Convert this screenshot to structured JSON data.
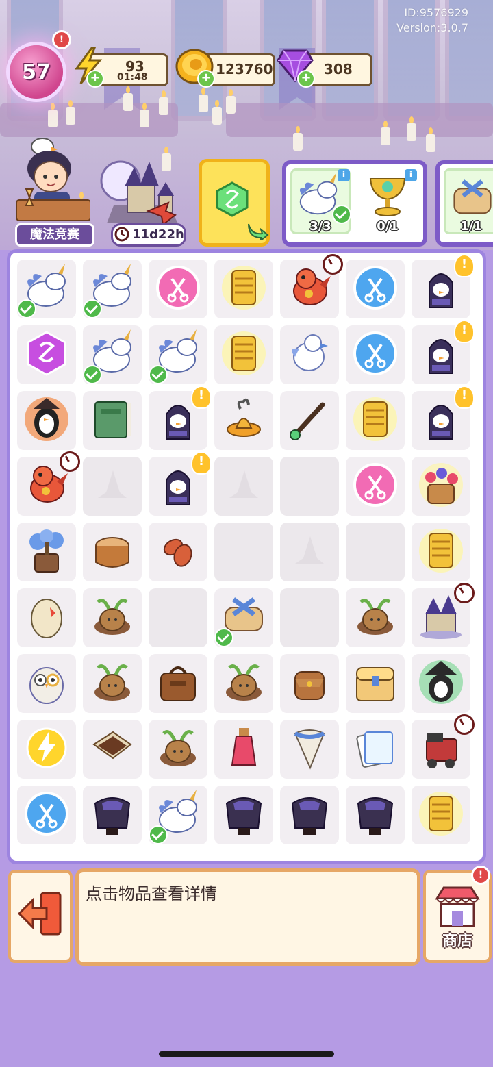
{
  "header": {
    "id_text": "ID:9576929",
    "version_text": "Version:3.0.7"
  },
  "player": {
    "level": "57"
  },
  "resources": {
    "energy": {
      "value": "93",
      "timer": "01:48",
      "icon": "lightning-icon"
    },
    "coins": {
      "value": "123760",
      "icon": "coin-icon"
    },
    "gems": {
      "value": "308",
      "icon": "gem-icon"
    }
  },
  "event": {
    "label": "魔法竞赛",
    "castle_timer": "11d22h"
  },
  "orders": [
    {
      "item": "unicorn",
      "progress": "3/3",
      "done": true
    },
    {
      "item": "golden-goblet",
      "progress": "0/1",
      "done": false
    },
    {
      "item": "scroll-bundle",
      "progress": "1/1",
      "done": true
    }
  ],
  "board": {
    "rows": [
      [
        "unicorn|check",
        "unicorn|check",
        "scissors-pink",
        "golden-scroll",
        "red-dragon|clock",
        "scissors-blue",
        "penguin-wizard|bulb"
      ],
      [
        "hex-token",
        "unicorn|check",
        "unicorn|check",
        "golden-scroll",
        "white-bird",
        "scissors-blue",
        "penguin-wizard|bulb"
      ],
      [
        "fire-penguin",
        "green-book",
        "penguin-wizard|bulb",
        "magic-lamp",
        "magic-wand",
        "golden-scroll",
        "penguin-wizard|bulb"
      ],
      [
        "red-dragon|clock",
        "empty-hat",
        "penguin-wizard|bulb",
        "empty-hat",
        "empty",
        "scissors-pink",
        "flower-basket"
      ],
      [
        "tree-pot",
        "tree-stump",
        "leaves",
        "empty",
        "empty-hat",
        "empty",
        "golden-scroll"
      ],
      [
        "cracked-egg",
        "mandrake",
        "empty",
        "scroll-bundle|check",
        "empty",
        "mandrake",
        "castle|clock"
      ],
      [
        "owl",
        "mandrake",
        "leather-bag",
        "mandrake",
        "satchel",
        "treasure-chest",
        "dark-wizard"
      ],
      [
        "energy-coin",
        "chocolate-bar",
        "mandrake",
        "potion-bottle",
        "fang",
        "cards",
        "steam-train|clock"
      ],
      [
        "scissors-blue",
        "wizard-robe",
        "unicorn|check",
        "wizard-robe",
        "wizard-robe",
        "wizard-robe",
        "golden-scroll"
      ]
    ]
  },
  "bottom": {
    "hint_text": "点击物品查看详情",
    "shop_label": "商店"
  },
  "colors": {
    "background": "#b59be4",
    "board_border": "#9d84e0",
    "panel_border": "#e6a766",
    "check_green": "#4fb94a"
  }
}
